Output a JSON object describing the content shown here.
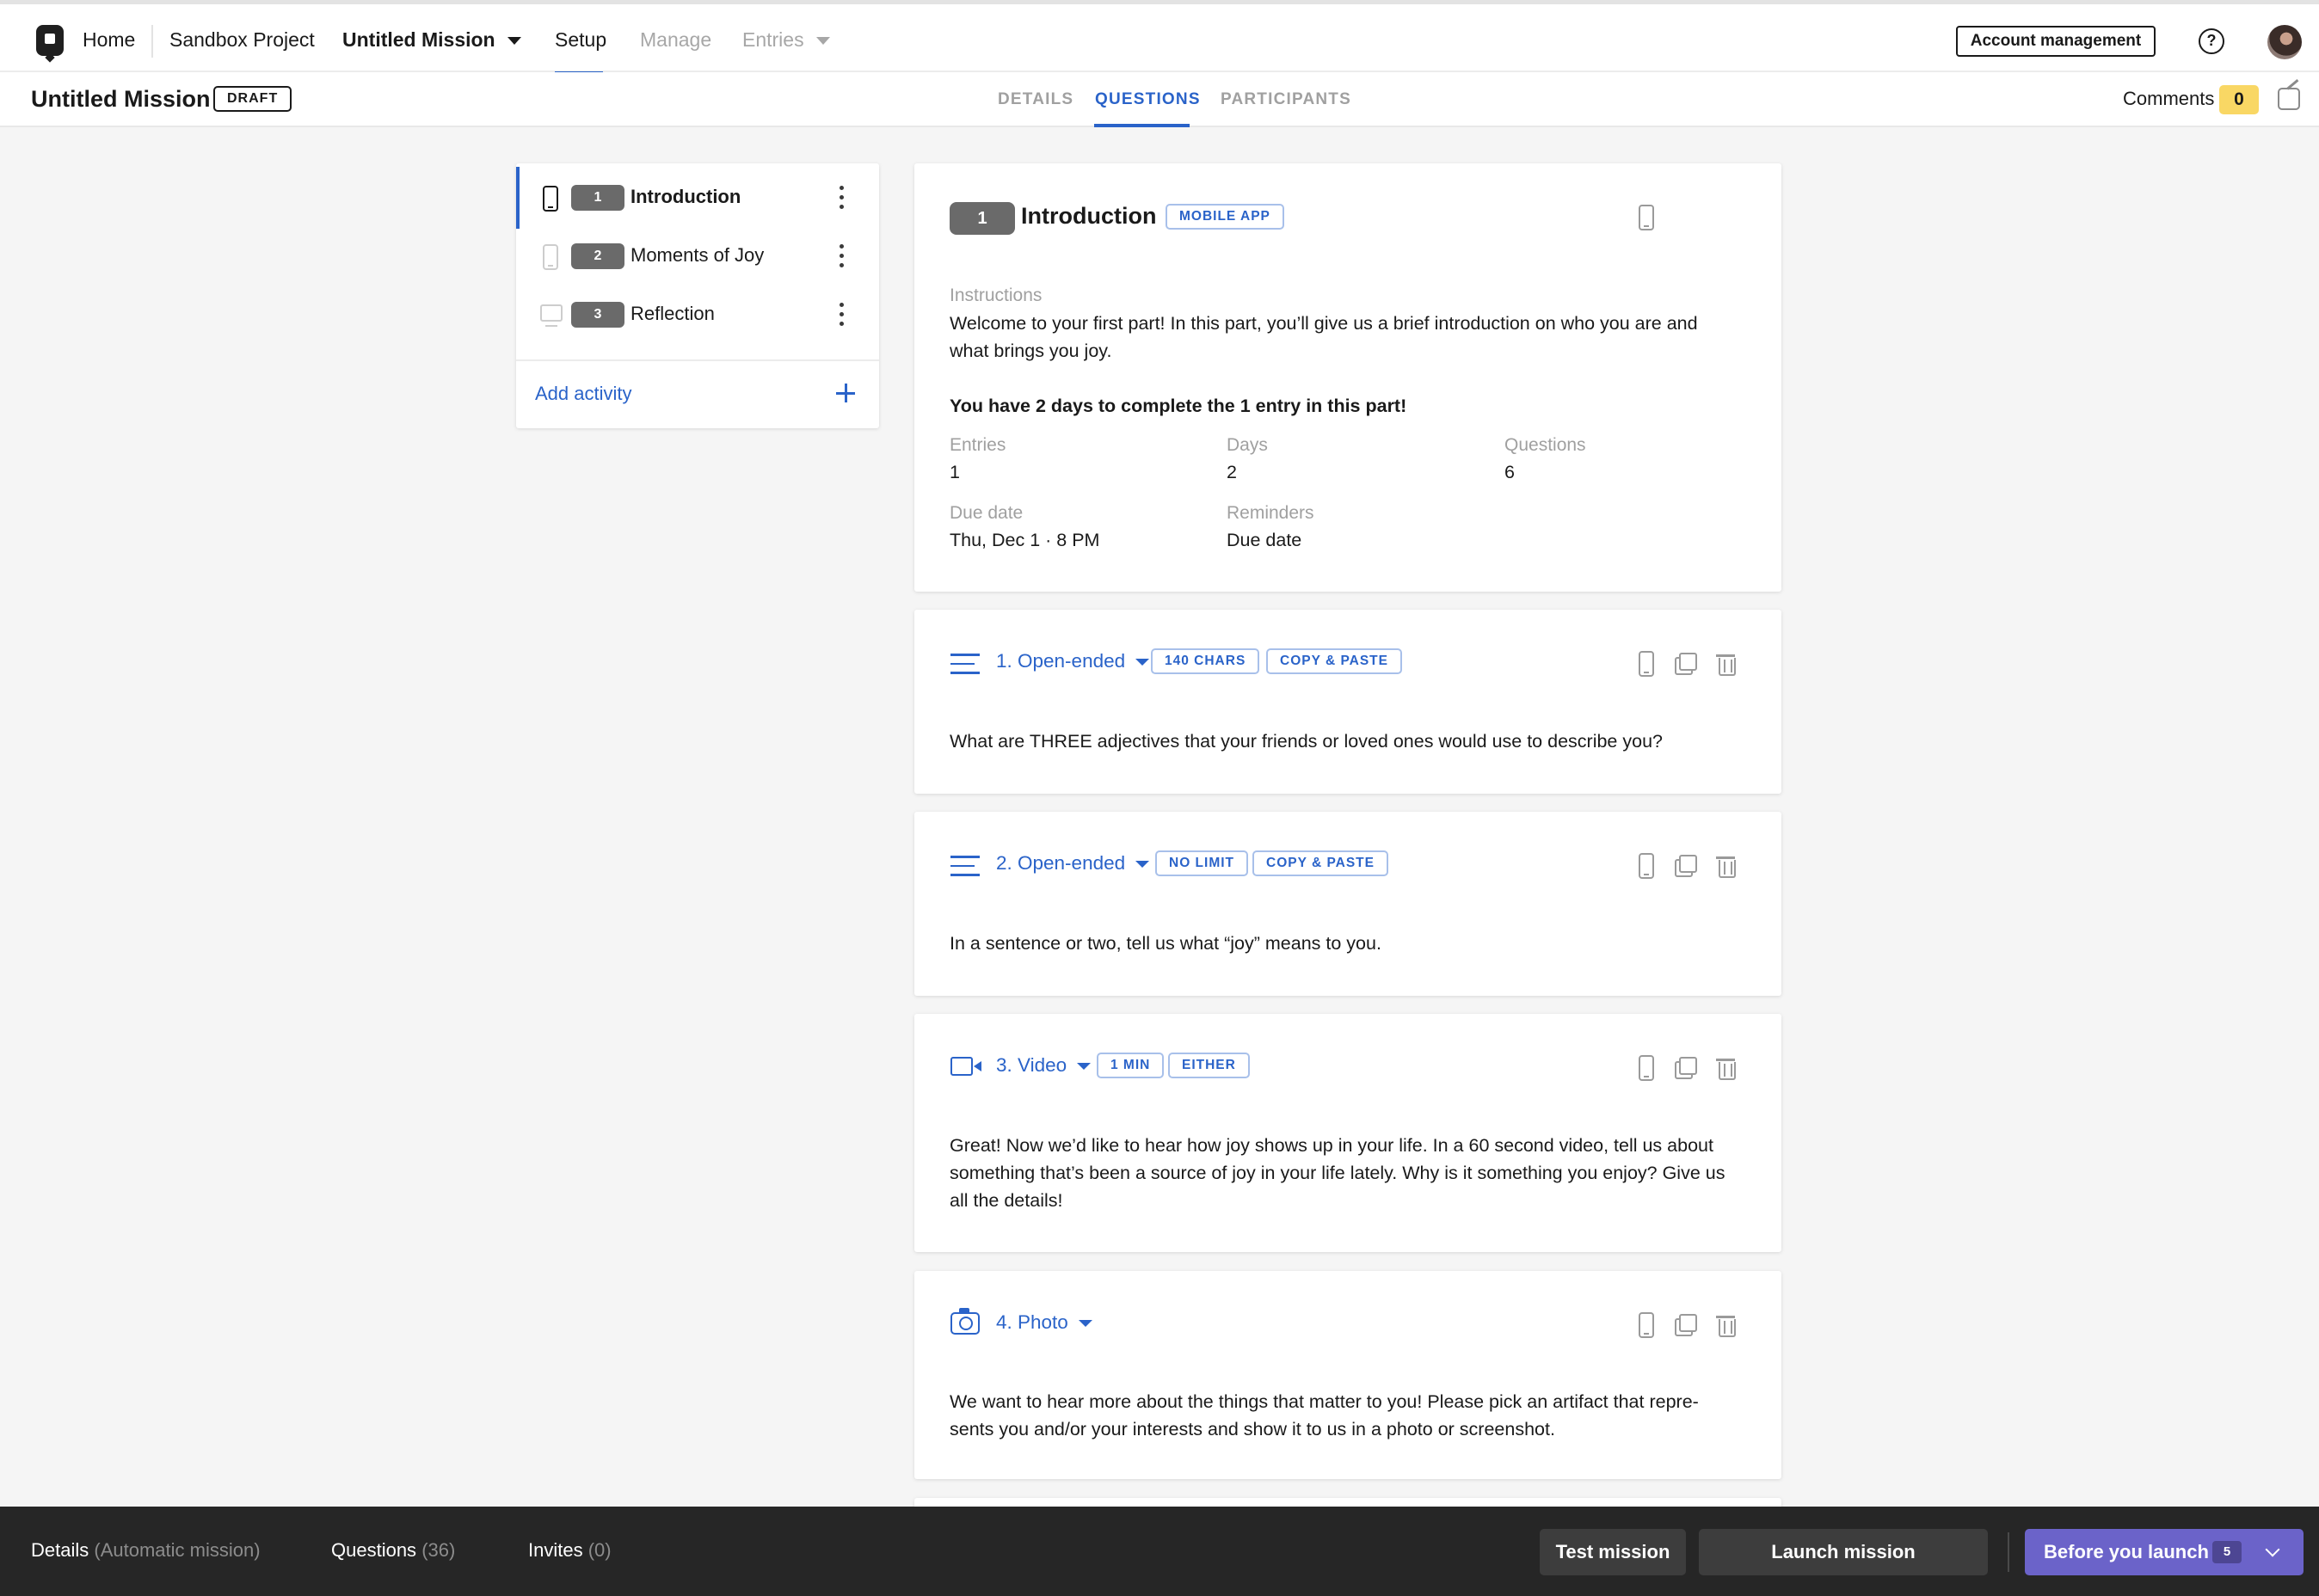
{
  "nav": {
    "home": "Home",
    "project": "Sandbox Project",
    "mission": "Untitled Mission",
    "setup": "Setup",
    "manage": "Manage",
    "entries": "Entries",
    "account": "Account management",
    "help": "?"
  },
  "subnav": {
    "title": "Untitled Mission",
    "status": "DRAFT",
    "tabs": [
      "DETAILS",
      "QUESTIONS",
      "PARTICIPANTS"
    ],
    "active_tab": "QUESTIONS",
    "comments_label": "Comments",
    "comments_count": "0"
  },
  "activities": [
    {
      "number": "1",
      "label": "Introduction",
      "device": "mobile",
      "active": true
    },
    {
      "number": "2",
      "label": "Moments of Joy",
      "device": "mobile",
      "active": false
    },
    {
      "number": "3",
      "label": "Reflection",
      "device": "desktop",
      "active": false
    }
  ],
  "add_activity": "Add activity",
  "intro": {
    "number": "1",
    "title": "Introduction",
    "tag": "MOBILE APP",
    "instructions_label": "Instructions",
    "instructions": "Welcome to your first part! In this part, you’ll give us a brief introduction on who you are and what brings you joy.",
    "deadline": "You have 2 days to complete the 1 entry in this part!",
    "fields": {
      "entries_label": "Entries",
      "entries": "1",
      "days_label": "Days",
      "days": "2",
      "questions_label": "Questions",
      "questions": "6",
      "due_label": "Due date",
      "due": "Thu, Dec 1 · 8 PM",
      "reminders_label": "Reminders",
      "reminders": "Due date"
    }
  },
  "questions": [
    {
      "type": "1. Open-ended",
      "icon": "lines-icon",
      "tags": [
        "140 CHARS",
        "COPY & PASTE"
      ],
      "text": "What are THREE adjectives that your friends or loved ones would use to describe you?"
    },
    {
      "type": "2. Open-ended",
      "icon": "lines-icon",
      "tags": [
        "NO LIMIT",
        "COPY & PASTE"
      ],
      "text": "In a sentence or two, tell us what “joy” means to you."
    },
    {
      "type": "3. Video",
      "icon": "video-icon",
      "tags": [
        "1 MIN",
        "EITHER"
      ],
      "text": "Great! Now we’d like to hear how joy shows up in your life. In a 60 second video, tell us about something that’s been a source of joy in your life lately. Why is it something you enjoy? Give us all the details!"
    },
    {
      "type": "4. Photo",
      "icon": "camera-icon",
      "tags": [],
      "text": "We want to hear more about the things that matter to you! Please pick an artifact that repre-sents you and/or your interests and show it to us in a photo or screenshot."
    }
  ],
  "bottom": {
    "details": "Details",
    "details_sub": "(Automatic mission)",
    "questions": "Questions",
    "questions_sub": "(36)",
    "invites": "Invites",
    "invites_sub": "(0)",
    "test": "Test mission",
    "launch": "Launch mission",
    "before": "Before you launch",
    "before_count": "5"
  },
  "colors": {
    "accent": "#2a63c9",
    "launch_button": "#6b63c9",
    "comments_badge": "#f9d764"
  }
}
